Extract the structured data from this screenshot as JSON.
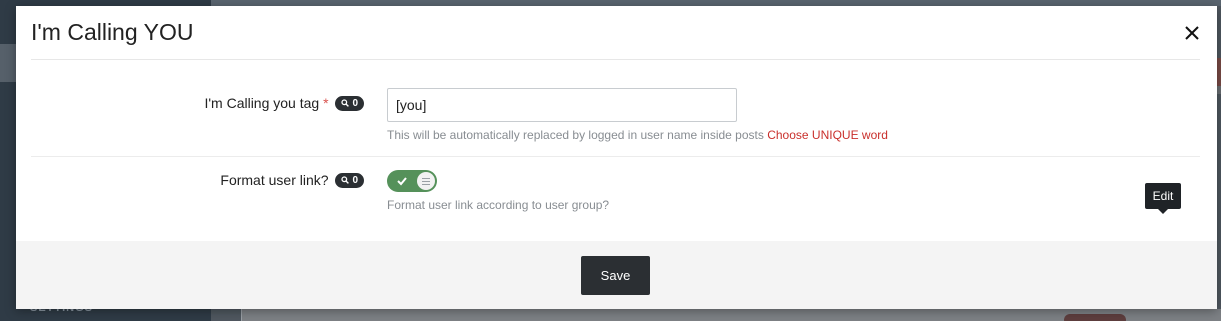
{
  "modal": {
    "title": "I'm Calling YOU"
  },
  "fields": [
    {
      "label": "I'm Calling you tag",
      "required_marker": "*",
      "badge_count": "0",
      "value": "[you]",
      "help": "This will be automatically replaced by logged in user name inside posts",
      "help_accent": "Choose UNIQUE word"
    },
    {
      "label": "Format user link?",
      "badge_count": "0",
      "toggle_on": true,
      "help": "Format user link according to user group?"
    }
  ],
  "tooltip": {
    "text": "Edit"
  },
  "footer": {
    "save_label": "Save"
  },
  "background": {
    "sidebar_section": "SETTINGS"
  },
  "colors": {
    "toggle_on": "#55915a",
    "accent_text": "#c9302c",
    "dark_button": "#2b2f33"
  }
}
